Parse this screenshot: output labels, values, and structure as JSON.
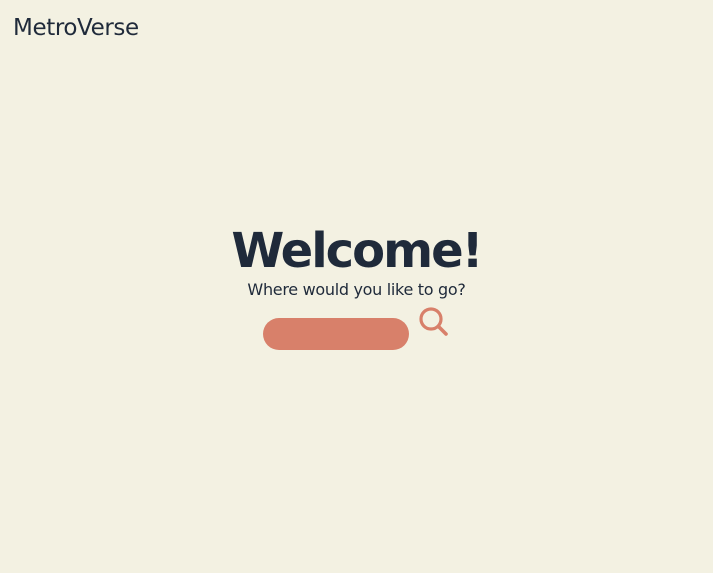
{
  "header": {
    "brand": "MetroVerse"
  },
  "hero": {
    "title": "Welcome!",
    "subtitle": "Where would you like to go?"
  },
  "search": {
    "value": "",
    "placeholder": "",
    "icon": "search-icon"
  },
  "colors": {
    "background": "#f3f1e2",
    "text": "#1f2a3a",
    "accent": "#d8806a"
  }
}
